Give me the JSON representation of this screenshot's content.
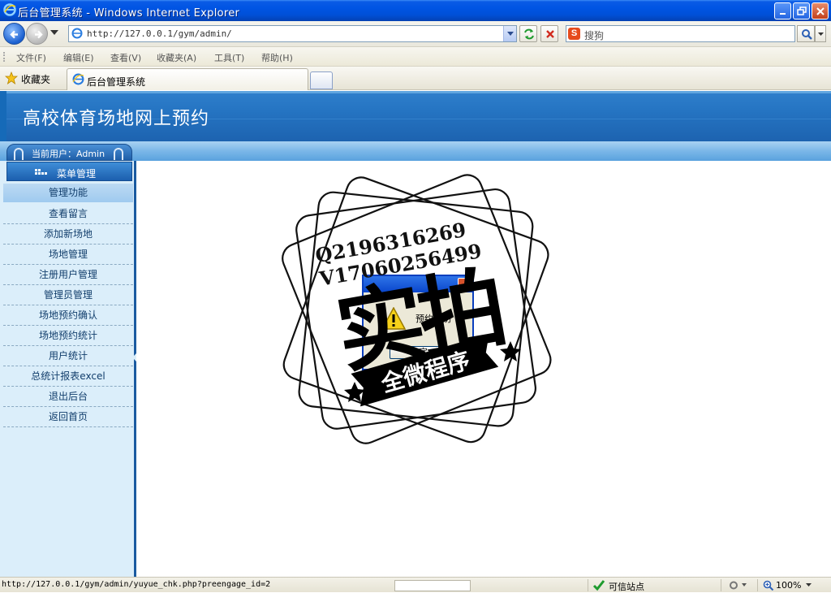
{
  "window": {
    "title": "后台管理系统 - Windows Internet Explorer"
  },
  "address_bar": {
    "url": "http://127.0.0.1/gym/admin/",
    "search_placeholder": "搜狗"
  },
  "menu_bar": {
    "items": [
      "文件(F)",
      "编辑(E)",
      "查看(V)",
      "收藏夹(A)",
      "工具(T)",
      "帮助(H)"
    ]
  },
  "favorites_bar": {
    "favorites_label": "收藏夹",
    "tab_label": "后台管理系统"
  },
  "page": {
    "site_title": "高校体育场地网上预约",
    "current_user": "当前用户：Admin",
    "menu_header": "菜单管理",
    "menu_category": "管理功能",
    "menu_items": [
      "查看留言",
      "添加新场地",
      "场地管理",
      "注册用户管理",
      "管理员管理",
      "场地预约确认",
      "场地预约统计",
      "用户统计",
      "总统计报表excel",
      "退出后台",
      "返回首页"
    ]
  },
  "dialog": {
    "message": "预约成功",
    "ok_label": "确定"
  },
  "watermark": {
    "line1": "Q2196316269",
    "line2": "V17060256499",
    "main": "实拍",
    "ribbon": "全微程序"
  },
  "status_bar": {
    "url": "http://127.0.0.1/gym/admin/yuyue_chk.php?preengage_id=2",
    "zone": "可信站点",
    "zoom": "100%"
  },
  "colors": {
    "banner": "#2574c2",
    "sidebar_bg": "#dbeefa",
    "sidebar_border": "#1a5aa0",
    "titlebar": "#0054e3"
  }
}
